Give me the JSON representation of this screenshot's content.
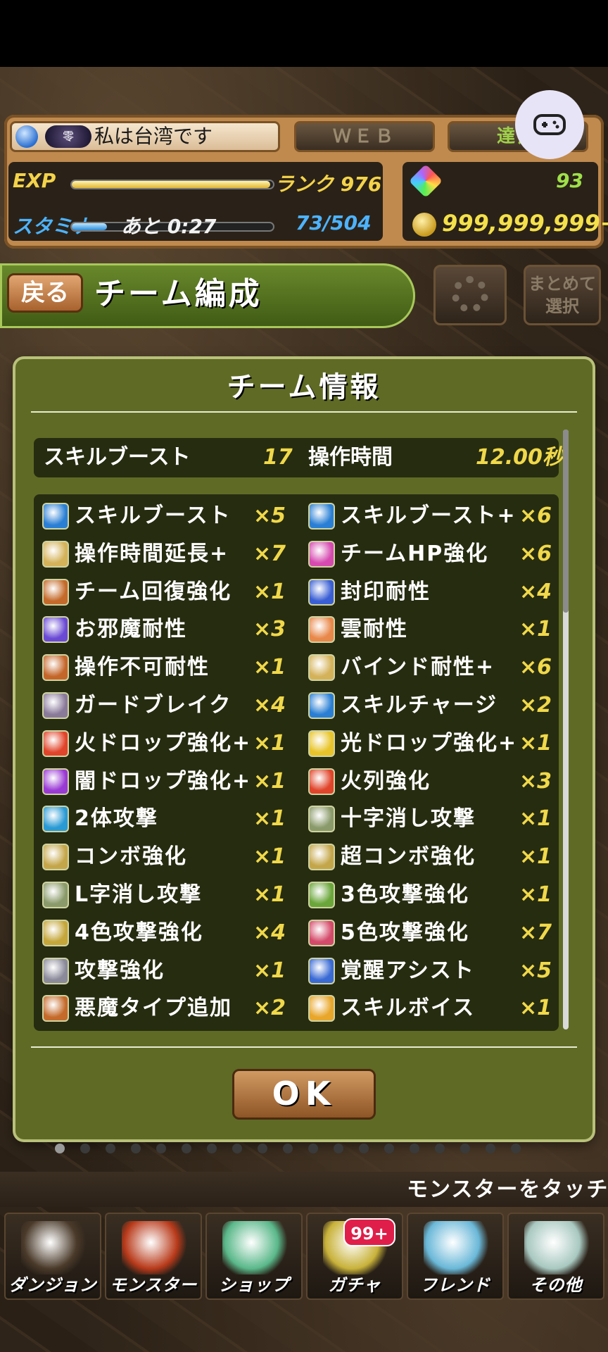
{
  "header": {
    "player_name": "私は台湾です",
    "avatar_text": "零",
    "web_label": "ＷＥＢ",
    "achievements_label": "達成",
    "exp_label": "EXP",
    "rank_text": "ランク 976",
    "stamina_label": "スタミナ",
    "stamina_timer": "あと 0:27",
    "stamina_value": "73/504",
    "stone_count": "93",
    "coin_count": "999,999,999+"
  },
  "titlebar": {
    "back_label": "戻る",
    "title": "チーム編成",
    "bulk_select_label": "まとめて選択"
  },
  "dialog": {
    "title": "チーム情報",
    "summary": {
      "skill_boost_label": "スキルブースト",
      "skill_boost_value": "17",
      "move_time_label": "操作時間",
      "move_time_value": "12.00秒"
    },
    "awakenings": [
      {
        "name": "スキルブースト",
        "count": "×5",
        "color": "#2a7fd4"
      },
      {
        "name": "スキルブースト+",
        "count": "×6",
        "color": "#2a7fd4"
      },
      {
        "name": "操作時間延長+",
        "count": "×7",
        "color": "#d4b25a"
      },
      {
        "name": "チームHP強化",
        "count": "×6",
        "color": "#d64ab0"
      },
      {
        "name": "チーム回復強化",
        "count": "×1",
        "color": "#c46a2a"
      },
      {
        "name": "封印耐性",
        "count": "×4",
        "color": "#3a5fd4"
      },
      {
        "name": "お邪魔耐性",
        "count": "×3",
        "color": "#6a4ad4"
      },
      {
        "name": "雲耐性",
        "count": "×1",
        "color": "#e8884a"
      },
      {
        "name": "操作不可耐性",
        "count": "×1",
        "color": "#c4662a"
      },
      {
        "name": "バインド耐性+",
        "count": "×6",
        "color": "#d4b25a"
      },
      {
        "name": "ガードブレイク",
        "count": "×4",
        "color": "#8a7a9a"
      },
      {
        "name": "スキルチャージ",
        "count": "×2",
        "color": "#2a7fd4"
      },
      {
        "name": "火ドロップ強化+",
        "count": "×1",
        "color": "#e0442a"
      },
      {
        "name": "光ドロップ強化+",
        "count": "×1",
        "color": "#e8c42a"
      },
      {
        "name": "闇ドロップ強化+",
        "count": "×1",
        "color": "#9a3ad4"
      },
      {
        "name": "火列強化",
        "count": "×3",
        "color": "#e0442a"
      },
      {
        "name": "2体攻撃",
        "count": "×1",
        "color": "#2a9ad4"
      },
      {
        "name": "十字消し攻撃",
        "count": "×1",
        "color": "#8a9a6a"
      },
      {
        "name": "コンボ強化",
        "count": "×1",
        "color": "#c4a64a"
      },
      {
        "name": "超コンボ強化",
        "count": "×1",
        "color": "#c4a64a"
      },
      {
        "name": "L字消し攻撃",
        "count": "×1",
        "color": "#8a9a6a"
      },
      {
        "name": "3色攻撃強化",
        "count": "×1",
        "color": "#6aa63a"
      },
      {
        "name": "4色攻撃強化",
        "count": "×4",
        "color": "#c4a63a"
      },
      {
        "name": "5色攻撃強化",
        "count": "×7",
        "color": "#d44a6a"
      },
      {
        "name": "攻撃強化",
        "count": "×1",
        "color": "#8a8a9a"
      },
      {
        "name": "覚醒アシスト",
        "count": "×5",
        "color": "#3a6ad4"
      },
      {
        "name": "悪魔タイプ追加",
        "count": "×2",
        "color": "#c46a2a"
      },
      {
        "name": "スキルボイス",
        "count": "×1",
        "color": "#e8a62a"
      }
    ],
    "ok_label": "OK"
  },
  "footer": {
    "hint": "モンスターをタッチ",
    "tabs": [
      {
        "label": "ダンジョン",
        "color": "#4a3a2a"
      },
      {
        "label": "モンスター",
        "color": "#b83a1a"
      },
      {
        "label": "ショップ",
        "color": "#5ab88a"
      },
      {
        "label": "ガチャ",
        "color": "#c8b23a"
      },
      {
        "label": "フレンド",
        "color": "#6ab8d8"
      },
      {
        "label": "その他",
        "color": "#a8c8c0"
      }
    ],
    "gacha_badge": "99+"
  }
}
